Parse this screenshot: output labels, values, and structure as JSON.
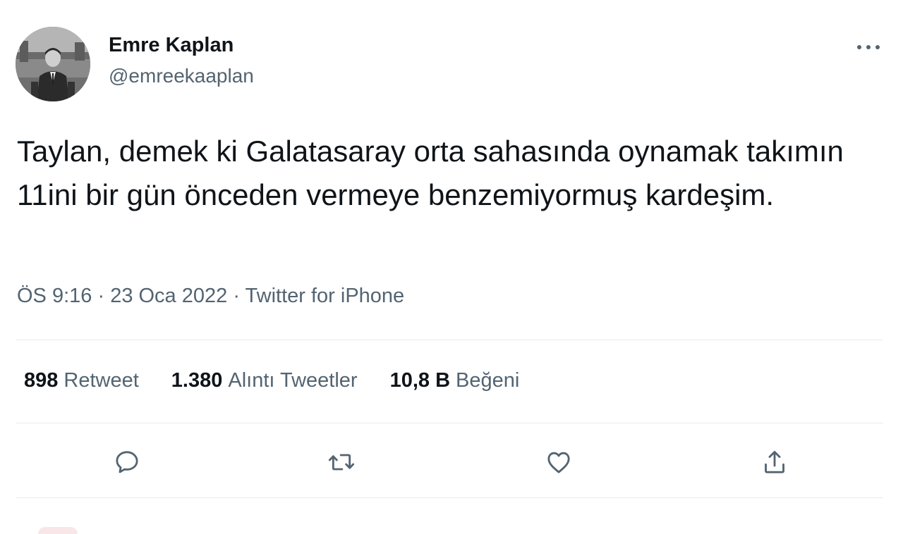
{
  "tweet": {
    "author": {
      "display_name": "Emre Kaplan",
      "handle": "@emreekaaplan",
      "avatar_icon": "profile-photo"
    },
    "more_icon": "more-horizontal-icon",
    "text": "Taylan, demek ki Galatasaray orta sahasında oynamak takımın 11ini bir gün önceden vermeye benzemiyormuş kardeşim.",
    "meta": {
      "time": "ÖS 9:16",
      "separator_1": " · ",
      "date": "23 Oca 2022",
      "separator_2": " · ",
      "source": "Twitter for iPhone"
    },
    "stats": {
      "retweets": {
        "count": "898",
        "label": "Retweet"
      },
      "quotes": {
        "count": "1.380",
        "label": "Alıntı Tweetler"
      },
      "likes": {
        "count": "10,8 B",
        "label": "Beğeni"
      }
    },
    "actions": [
      {
        "name": "reply",
        "icon": "comment-icon"
      },
      {
        "name": "retweet",
        "icon": "retweet-icon"
      },
      {
        "name": "like",
        "icon": "heart-icon"
      },
      {
        "name": "share",
        "icon": "share-icon"
      }
    ]
  },
  "colors": {
    "primary_text": "#0f1419",
    "secondary_text": "#536471",
    "divider": "#e6ecf0",
    "background": "#ffffff"
  }
}
